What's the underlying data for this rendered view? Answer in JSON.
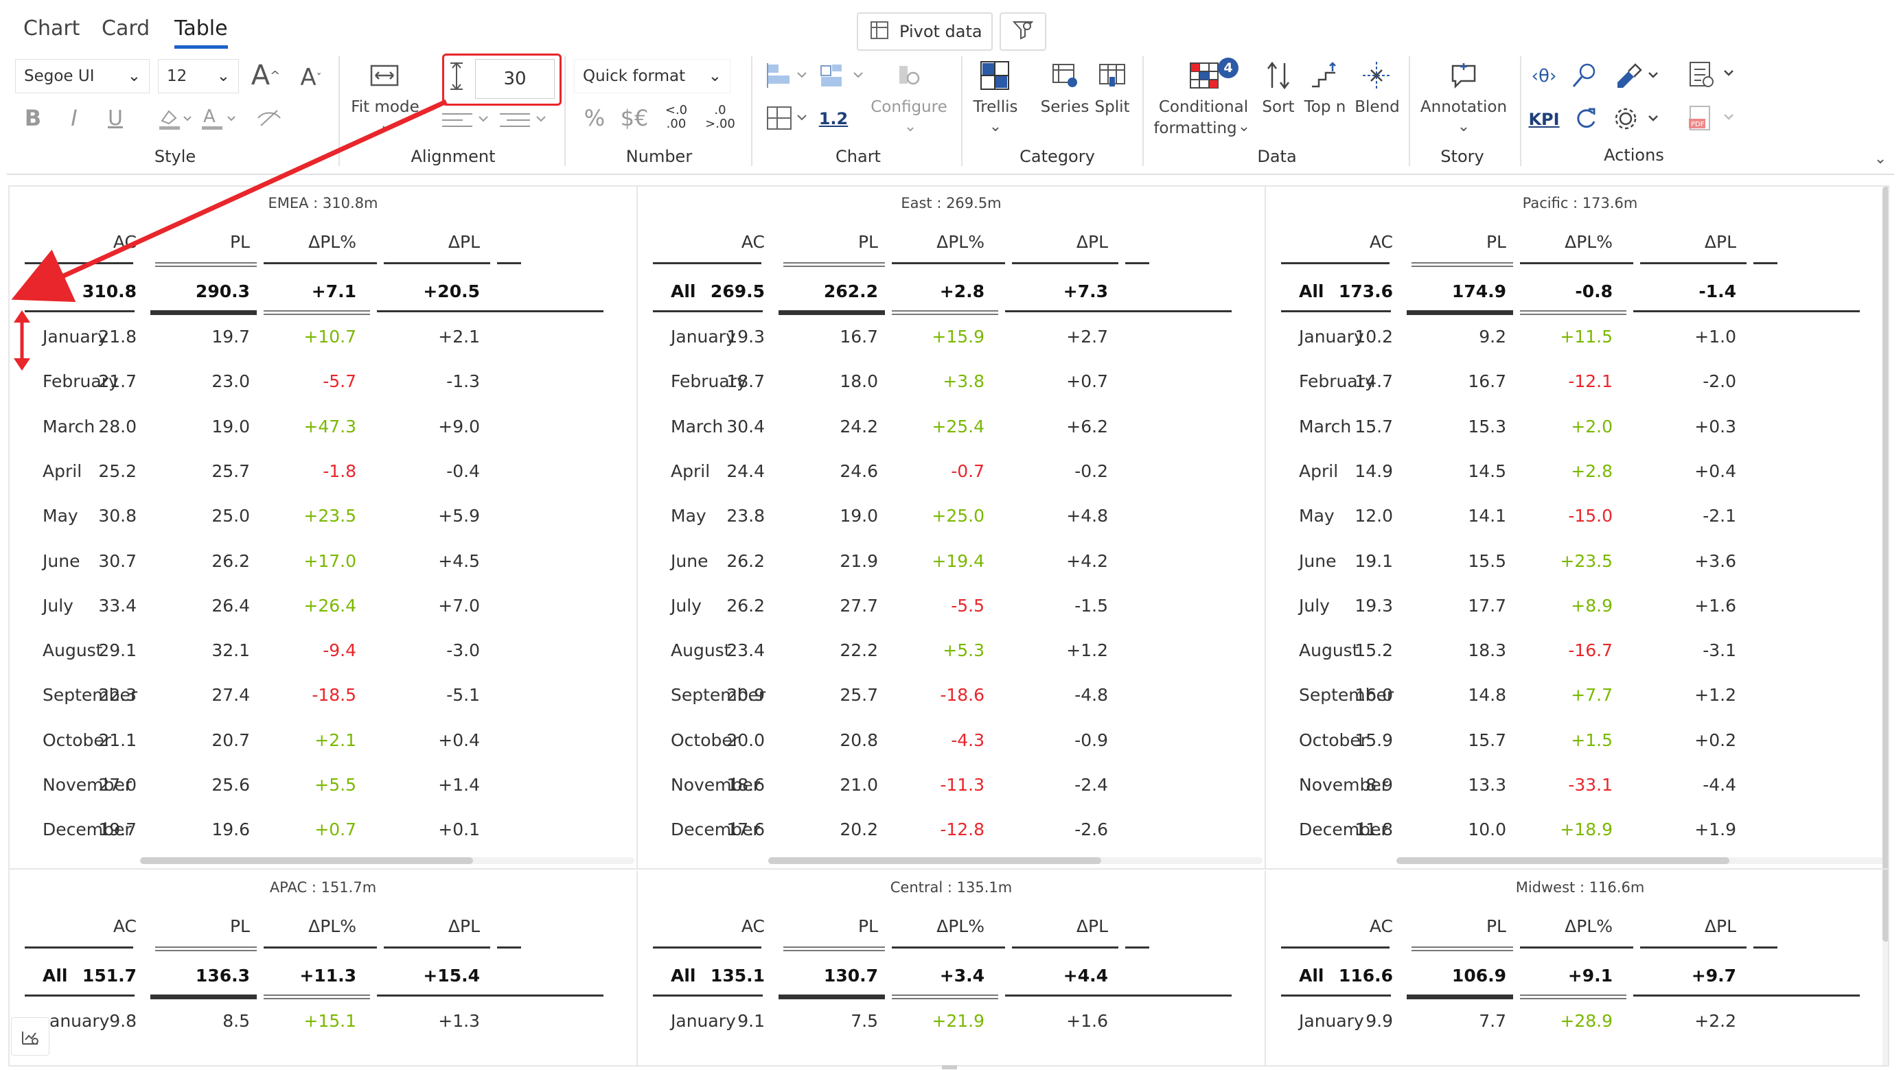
{
  "tabs": [
    "Chart",
    "Card",
    "Table"
  ],
  "pivot_label": "Pivot data",
  "style": {
    "font": "Segoe UI",
    "size": "12",
    "group": "Style"
  },
  "alignment": {
    "row_height": "30",
    "fit_mode": "Fit mode",
    "group": "Alignment"
  },
  "number": {
    "quick_format": "Quick format",
    "pct": "%",
    "currency": "$€",
    "dec_less": ".0",
    "dec_more": ".00",
    "group": "Number"
  },
  "chart": {
    "scale": "1.2",
    "configure": "Configure",
    "group": "Chart"
  },
  "category": {
    "trellis": "Trellis",
    "series": "Series",
    "split": "Split",
    "group": "Category"
  },
  "data_grp": {
    "conditional": "Conditional",
    "formatting": "formatting",
    "badge": "4",
    "sort": "Sort",
    "topn": "Top n",
    "blend": "Blend",
    "group": "Data"
  },
  "story": {
    "annotation": "Annotation",
    "group": "Story"
  },
  "actions": {
    "kpi": "KPI",
    "group": "Actions"
  },
  "columns": [
    "AC",
    "PL",
    "ΔPL%",
    "ΔPL"
  ],
  "months": [
    "January",
    "February",
    "March",
    "April",
    "May",
    "June",
    "July",
    "August",
    "September",
    "October",
    "November",
    "December"
  ],
  "panels": [
    {
      "title": "EMEA :  310.8m",
      "all": [
        "All",
        "310.8",
        "290.3",
        "+7.1",
        "+20.5"
      ],
      "rows": [
        [
          "21.8",
          "19.7",
          "+10.7",
          "+2.1"
        ],
        [
          "21.7",
          "23.0",
          "-5.7",
          "-1.3"
        ],
        [
          "28.0",
          "19.0",
          "+47.3",
          "+9.0"
        ],
        [
          "25.2",
          "25.7",
          "-1.8",
          "-0.4"
        ],
        [
          "30.8",
          "25.0",
          "+23.5",
          "+5.9"
        ],
        [
          "30.7",
          "26.2",
          "+17.0",
          "+4.5"
        ],
        [
          "33.4",
          "26.4",
          "+26.4",
          "+7.0"
        ],
        [
          "29.1",
          "32.1",
          "-9.4",
          "-3.0"
        ],
        [
          "22.3",
          "27.4",
          "-18.5",
          "-5.1"
        ],
        [
          "21.1",
          "20.7",
          "+2.1",
          "+0.4"
        ],
        [
          "27.0",
          "25.6",
          "+5.5",
          "+1.4"
        ],
        [
          "19.7",
          "19.6",
          "+0.7",
          "+0.1"
        ]
      ]
    },
    {
      "title": "East :  269.5m",
      "all": [
        "All",
        "269.5",
        "262.2",
        "+2.8",
        "+7.3"
      ],
      "rows": [
        [
          "19.3",
          "16.7",
          "+15.9",
          "+2.7"
        ],
        [
          "18.7",
          "18.0",
          "+3.8",
          "+0.7"
        ],
        [
          "30.4",
          "24.2",
          "+25.4",
          "+6.2"
        ],
        [
          "24.4",
          "24.6",
          "-0.7",
          "-0.2"
        ],
        [
          "23.8",
          "19.0",
          "+25.0",
          "+4.8"
        ],
        [
          "26.2",
          "21.9",
          "+19.4",
          "+4.2"
        ],
        [
          "26.2",
          "27.7",
          "-5.5",
          "-1.5"
        ],
        [
          "23.4",
          "22.2",
          "+5.3",
          "+1.2"
        ],
        [
          "20.9",
          "25.7",
          "-18.6",
          "-4.8"
        ],
        [
          "20.0",
          "20.8",
          "-4.3",
          "-0.9"
        ],
        [
          "18.6",
          "21.0",
          "-11.3",
          "-2.4"
        ],
        [
          "17.6",
          "20.2",
          "-12.8",
          "-2.6"
        ]
      ]
    },
    {
      "title": "Pacific :  173.6m",
      "all": [
        "All",
        "173.6",
        "174.9",
        "-0.8",
        "-1.4"
      ],
      "rows": [
        [
          "10.2",
          "9.2",
          "+11.5",
          "+1.0"
        ],
        [
          "14.7",
          "16.7",
          "-12.1",
          "-2.0"
        ],
        [
          "15.7",
          "15.3",
          "+2.0",
          "+0.3"
        ],
        [
          "14.9",
          "14.5",
          "+2.8",
          "+0.4"
        ],
        [
          "12.0",
          "14.1",
          "-15.0",
          "-2.1"
        ],
        [
          "19.1",
          "15.5",
          "+23.5",
          "+3.6"
        ],
        [
          "19.3",
          "17.7",
          "+8.9",
          "+1.6"
        ],
        [
          "15.2",
          "18.3",
          "-16.7",
          "-3.1"
        ],
        [
          "16.0",
          "14.8",
          "+7.7",
          "+1.2"
        ],
        [
          "15.9",
          "15.7",
          "+1.5",
          "+0.2"
        ],
        [
          "8.9",
          "13.3",
          "-33.1",
          "-4.4"
        ],
        [
          "11.8",
          "10.0",
          "+18.9",
          "+1.9"
        ]
      ]
    },
    {
      "title": "APAC :  151.7m",
      "all": [
        "All",
        "151.7",
        "136.3",
        "+11.3",
        "+15.4"
      ],
      "rows": [
        [
          "9.8",
          "8.5",
          "+15.1",
          "+1.3"
        ]
      ],
      "first_cat": "anuary"
    },
    {
      "title": "Central :  135.1m",
      "all": [
        "All",
        "135.1",
        "130.7",
        "+3.4",
        "+4.4"
      ],
      "rows": [
        [
          "9.1",
          "7.5",
          "+21.9",
          "+1.6"
        ]
      ]
    },
    {
      "title": "Midwest :  116.6m",
      "all": [
        "All",
        "116.6",
        "106.9",
        "+9.1",
        "+9.7"
      ],
      "rows": [
        [
          "9.9",
          "7.7",
          "+28.9",
          "+2.2"
        ]
      ]
    }
  ]
}
